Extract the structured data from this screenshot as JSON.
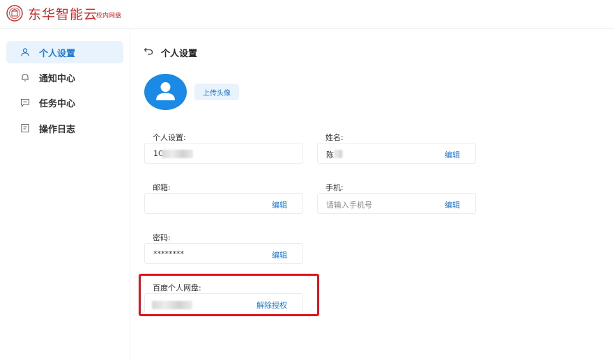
{
  "header": {
    "brand": "东华智能云",
    "brand_sub": "校内网盘",
    "logo_icon": "university-seal-icon"
  },
  "sidebar": {
    "items": [
      {
        "label": "个人设置",
        "icon": "user-icon",
        "active": true
      },
      {
        "label": "通知中心",
        "icon": "bell-icon",
        "active": false
      },
      {
        "label": "任务中心",
        "icon": "chat-icon",
        "active": false
      },
      {
        "label": "操作日志",
        "icon": "log-icon",
        "active": false
      }
    ]
  },
  "main": {
    "title": "个人设置",
    "upload_avatar_label": "上传头像",
    "fields": {
      "account": {
        "label": "个人设置:",
        "value": "1C"
      },
      "name": {
        "label": "姓名:",
        "value": "陈",
        "edit": "编辑"
      },
      "email": {
        "label": "邮箱:",
        "value": "",
        "edit": "编辑"
      },
      "phone": {
        "label": "手机:",
        "placeholder": "请输入手机号",
        "edit": "编辑"
      },
      "password": {
        "label": "密码:",
        "value": "********",
        "edit": "编辑"
      },
      "baidu": {
        "label": "百度个人网盘:",
        "value": "",
        "action": "解除授权"
      }
    }
  },
  "colors": {
    "brand_red": "#c42b2b",
    "accent_blue": "#1f78d1",
    "active_bg": "#e9f3fd",
    "highlight_red": "#e0141b"
  }
}
